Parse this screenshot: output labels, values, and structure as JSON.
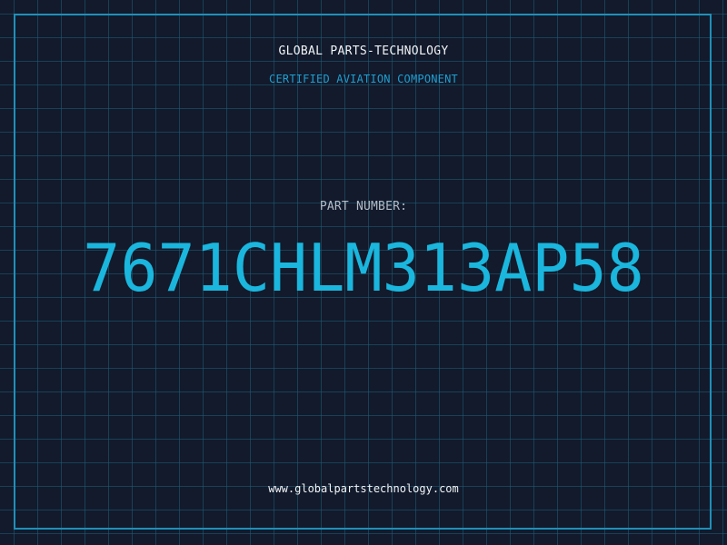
{
  "header": {
    "company": "GLOBAL PARTS-TECHNOLOGY",
    "subtitle": "CERTIFIED AVIATION COMPONENT"
  },
  "part": {
    "label": "PART NUMBER:",
    "number": "7671CHLM313AP58"
  },
  "footer": {
    "website": "www.globalpartstechnology.com"
  },
  "colors": {
    "background": "#121a2c",
    "grid": "#1f5e78",
    "frame": "#1f8fb8",
    "accent": "#1ab6dd",
    "text": "#f2f4f6"
  }
}
